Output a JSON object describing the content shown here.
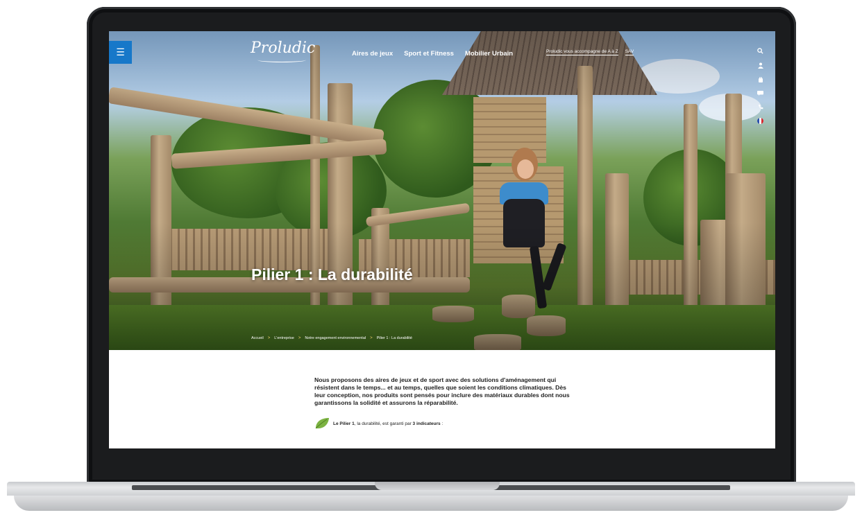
{
  "header": {
    "menu_icon": "☰",
    "logo": "Proludic",
    "nav": [
      "Aires de jeux",
      "Sport et Fitness",
      "Mobilier Urbain"
    ],
    "nav_right": [
      "Proludic vous accompagne de A à Z",
      "SAV"
    ],
    "side_icons": [
      "search-icon",
      "user-icon",
      "cart-icon",
      "chat-icon",
      "phone-icon",
      "flag-fr-icon"
    ]
  },
  "hero": {
    "title": "Pilier 1 : La durabilité",
    "breadcrumb": [
      "Accueil",
      "L'entreprise",
      "Notre engagement environnemental",
      "Pilier 1 : La durabilité"
    ],
    "breadcrumb_separator": ">"
  },
  "content": {
    "intro": "Nous proposons des aires de jeux et de sport avec des solutions d'aménagement qui résistent dans le temps... et au temps, quelles que soient les conditions climatiques. Dès leur conception, nos produits sont pensés pour inclure des matériaux durables dont nous garantissons la solidité et assurons la réparabilité.",
    "pillar_strong": "Le Pilier 1",
    "pillar_middle": ", la durabilité, est garanti par ",
    "pillar_count": "3 indicateurs",
    "pillar_end": " :"
  },
  "colors": {
    "accent": "#1778c9",
    "breadcrumb_separator": "#f1d36a",
    "leaf": "#7cb342"
  }
}
